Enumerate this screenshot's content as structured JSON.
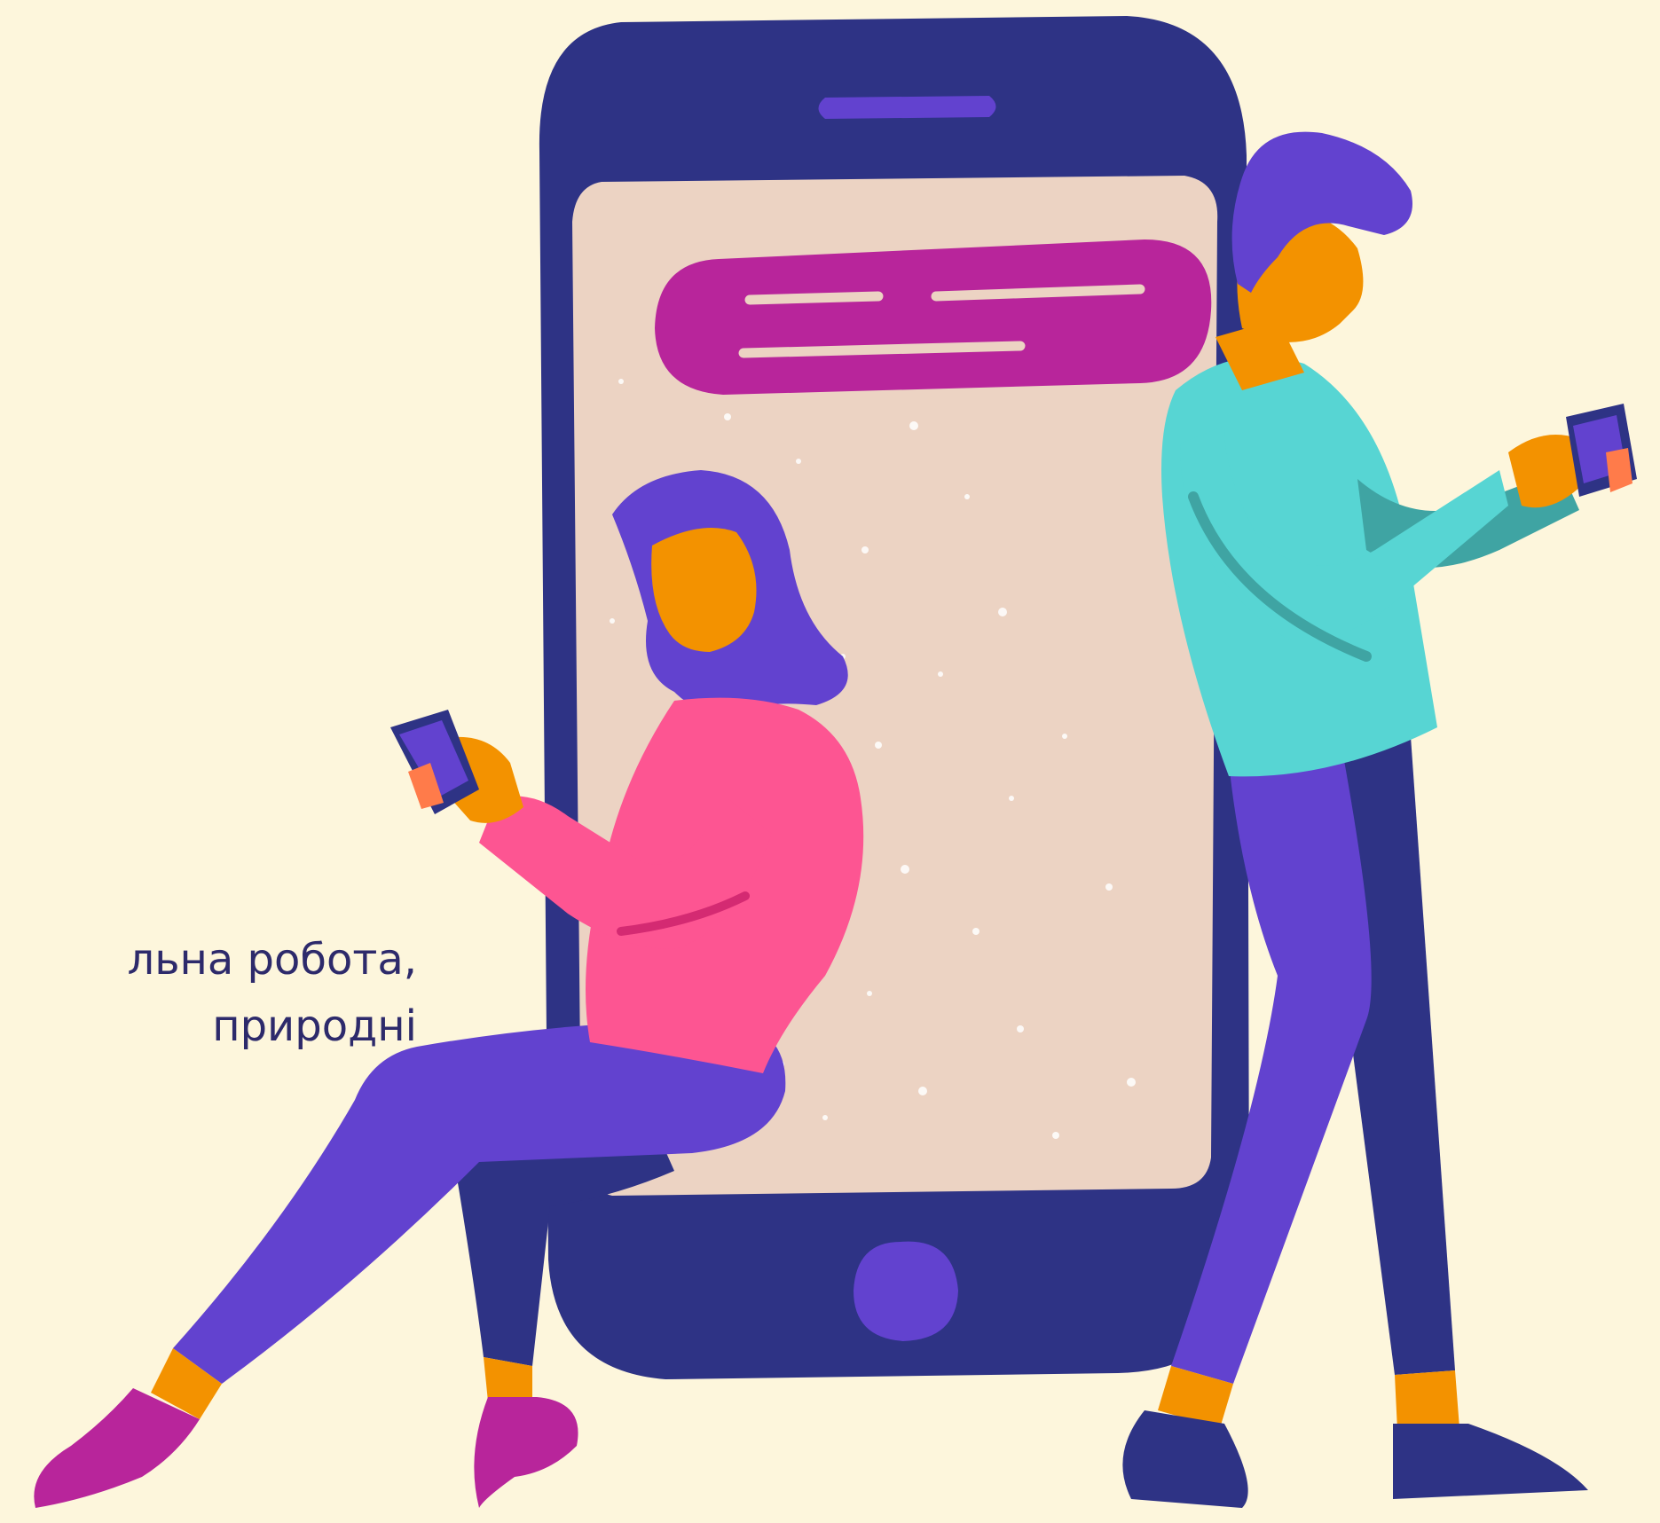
{
  "caption": {
    "line1": "льна робота,",
    "line2": "природні"
  },
  "illustration": {
    "icons": [
      "smartphone-icon",
      "chat-bubble-icon",
      "woman-figure",
      "man-figure"
    ]
  },
  "colors": {
    "background": "#fdf6dc",
    "phone_body": "#2e3385",
    "phone_screen": "#ecd3c3",
    "accent_purple": "#6242cf",
    "chat_bubble": "#b8259b",
    "skin": "#f39200",
    "woman_top": "#fd5592",
    "man_top": "#57d5d3",
    "shoe_magenta": "#b8259b",
    "caption_text": "#2d2a6b"
  }
}
